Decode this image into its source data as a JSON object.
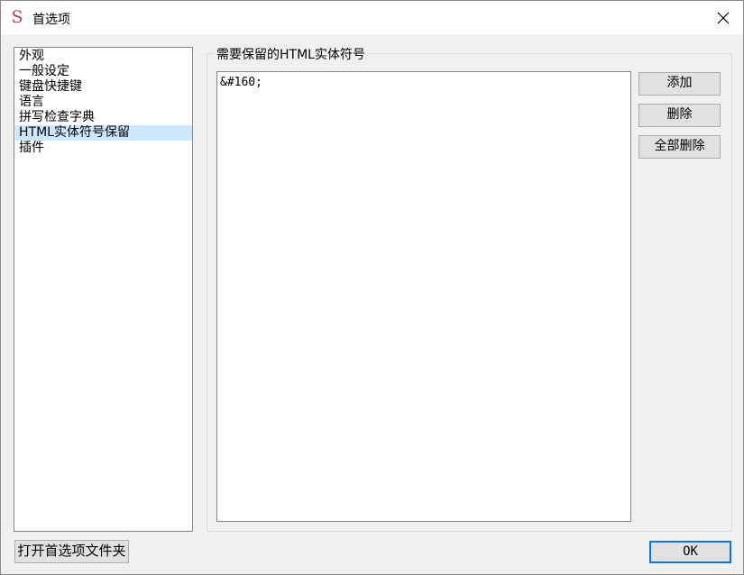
{
  "window": {
    "title": "首选项",
    "app_icon_glyph": "S",
    "accent_color": "#0078d7",
    "selection_color": "#cce8ff",
    "close_icon": "close-icon"
  },
  "sidebar": {
    "items": [
      {
        "label": "外观"
      },
      {
        "label": "一般设定"
      },
      {
        "label": "键盘快捷键"
      },
      {
        "label": "语言"
      },
      {
        "label": "拼写检查字典"
      },
      {
        "label": "HTML实体符号保留",
        "selected": true
      },
      {
        "label": "插件"
      }
    ]
  },
  "panel": {
    "group_label": "需要保留的HTML实体符号",
    "entities": [
      "&#160;"
    ],
    "buttons": {
      "add": "添加",
      "delete": "删除",
      "delete_all": "全部删除"
    }
  },
  "footer": {
    "open_folder": "打开首选项文件夹",
    "ok": "OK"
  }
}
